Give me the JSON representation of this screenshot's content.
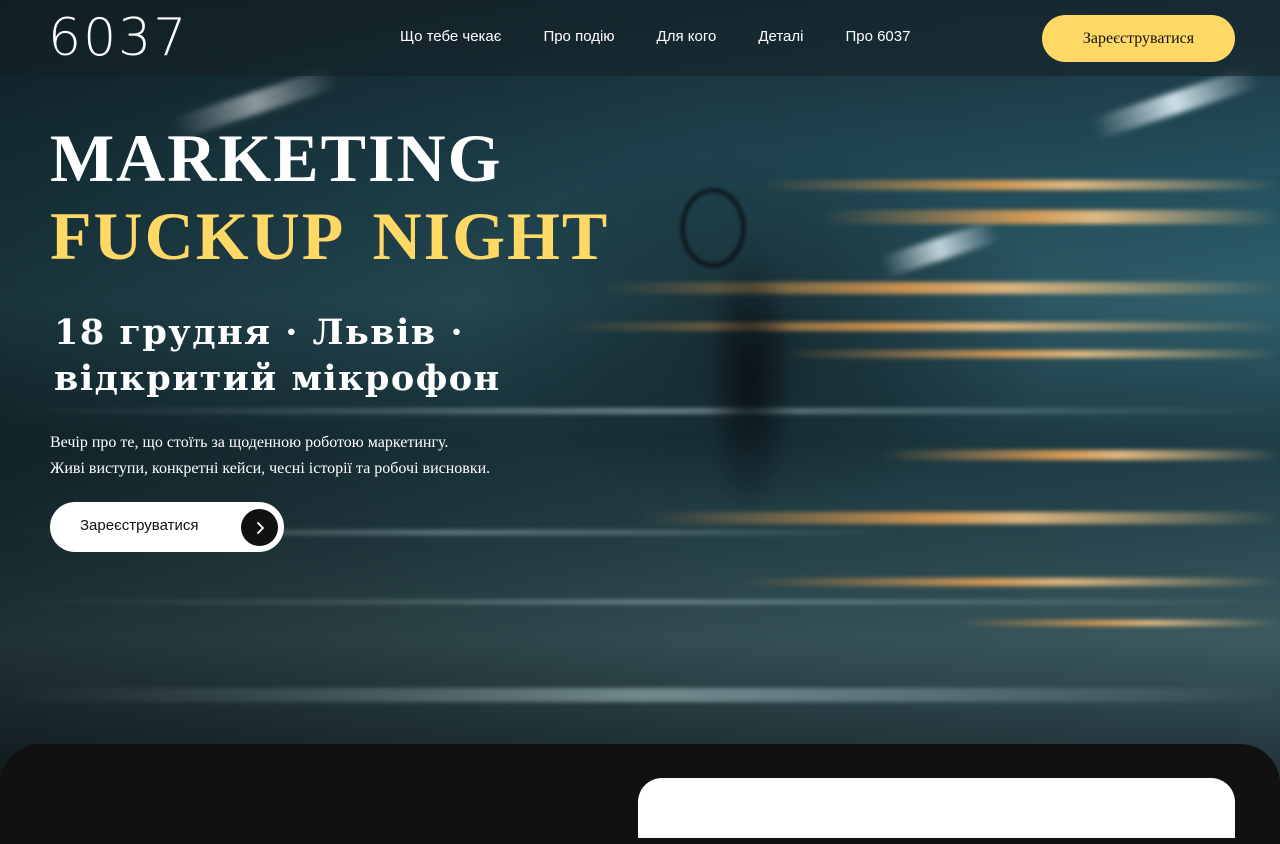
{
  "header": {
    "logo": "6037",
    "nav": [
      "Що тебе чекає",
      "Про подію",
      "Для кого",
      "Деталі",
      "Про 6037"
    ],
    "cta_label": "Зареєструватися"
  },
  "hero": {
    "title_line1": "MARKETING",
    "title_line2": "FUCKUP  NIGHT",
    "subtitle": "18 грудня · Львів · відкритий мікрофон",
    "desc_line1": "Вечір про те, що стоїть за щоденною роботою маркетингу.",
    "desc_line2": "Живі виступи, конкретні кейси, чесні історії та робочі висновки.",
    "cta_label": "Зареєструватися",
    "cta_icon": "chevron-right-icon"
  },
  "colors": {
    "accent": "#ffd866",
    "dark": "#111111",
    "text": "#ffffff"
  }
}
